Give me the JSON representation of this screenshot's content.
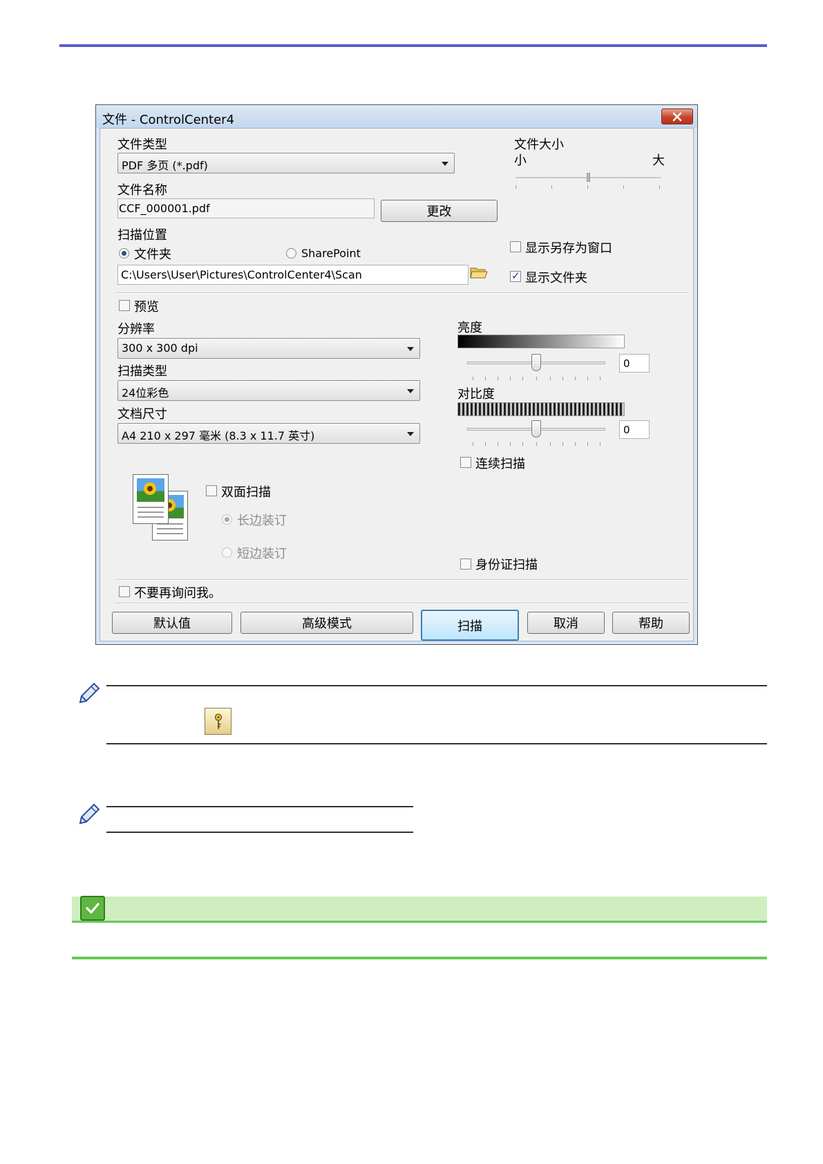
{
  "dialog": {
    "title": "文件 - ControlCenter4",
    "file_type": {
      "label": "文件类型",
      "value": "PDF 多页 (*.pdf)"
    },
    "file_size": {
      "label": "文件大小",
      "small_label": "小",
      "large_label": "大",
      "level": 0.5
    },
    "file_name": {
      "label": "文件名称",
      "value": "CCF_000001.pdf",
      "change_button": "更改"
    },
    "scan_location": {
      "label": "扫描位置",
      "folder_option": "文件夹",
      "sharepoint_option": "SharePoint",
      "selected": "folder",
      "path": "C:\\Users\\User\\Pictures\\ControlCenter4\\Scan"
    },
    "show_save_as_window": {
      "label": "显示另存为窗口",
      "checked": false
    },
    "show_folder": {
      "label": "显示文件夹",
      "checked": true
    },
    "preview": {
      "label": "预览",
      "checked": false
    },
    "resolution": {
      "label": "分辨率",
      "value": "300 x 300 dpi"
    },
    "scan_type": {
      "label": "扫描类型",
      "value": "24位彩色"
    },
    "document_size": {
      "label": "文档尺寸",
      "value": "A4 210 x 297 毫米 (8.3 x 11.7 英寸)"
    },
    "brightness": {
      "label": "亮度",
      "value": "0"
    },
    "contrast": {
      "label": "对比度",
      "value": "0"
    },
    "continuous_scan": {
      "label": "连续扫描",
      "checked": false
    },
    "duplex": {
      "label": "双面扫描",
      "checked": false,
      "long_edge": "长边装订",
      "short_edge": "短边装订",
      "selected": "long_edge"
    },
    "id_card_scan": {
      "label": "身份证扫描",
      "checked": false
    },
    "dont_ask_again": {
      "label": "不要再询问我。",
      "checked": false
    },
    "buttons": {
      "default": "默认值",
      "advanced": "高级模式",
      "scan": "扫描",
      "cancel": "取消",
      "help": "帮助"
    }
  },
  "icons": {
    "close": "close-icon",
    "folder": "folder-icon",
    "pencil": "pencil-icon",
    "key": "key-icon",
    "check": "checkmark-icon"
  },
  "colors": {
    "top_rule": "#5a5fc4",
    "green_band": "#cfeec0",
    "green_rule": "#68c95a"
  }
}
